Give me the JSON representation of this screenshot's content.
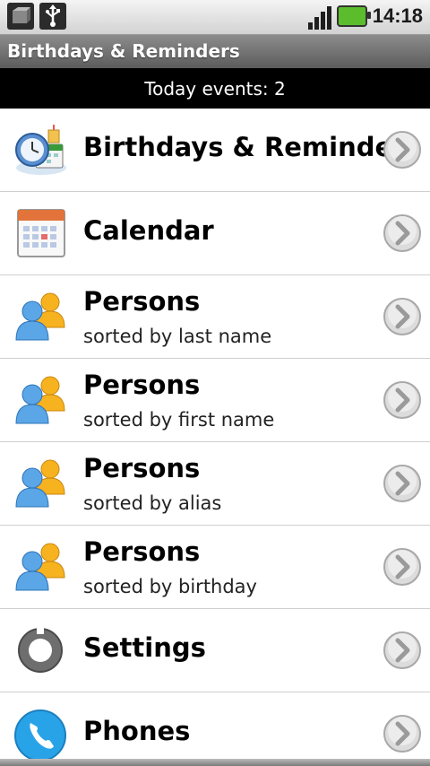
{
  "status_bar": {
    "time": "14:18",
    "icons": [
      "app-box-icon",
      "usb-icon",
      "signal-icon",
      "battery-icon"
    ]
  },
  "title_bar": {
    "title": "Birthdays & Reminders"
  },
  "today": {
    "text": "Today events: 2"
  },
  "menu": {
    "items": [
      {
        "label": "Birthdays & Reminders",
        "sub": "",
        "icon": "clock-calendar-icon"
      },
      {
        "label": "Calendar",
        "sub": "",
        "icon": "calendar-icon"
      },
      {
        "label": "Persons",
        "sub": "sorted by last name",
        "icon": "persons-icon"
      },
      {
        "label": "Persons",
        "sub": "sorted by first name",
        "icon": "persons-icon"
      },
      {
        "label": "Persons",
        "sub": "sorted by alias",
        "icon": "persons-icon"
      },
      {
        "label": "Persons",
        "sub": "sorted by birthday",
        "icon": "persons-icon"
      },
      {
        "label": "Settings",
        "sub": "",
        "icon": "settings-icon"
      },
      {
        "label": "Phones",
        "sub": "",
        "icon": "phone-icon"
      }
    ]
  },
  "colors": {
    "title_bar": "#6f6f6f",
    "today_band": "#000000",
    "battery": "#5bbd2b"
  }
}
